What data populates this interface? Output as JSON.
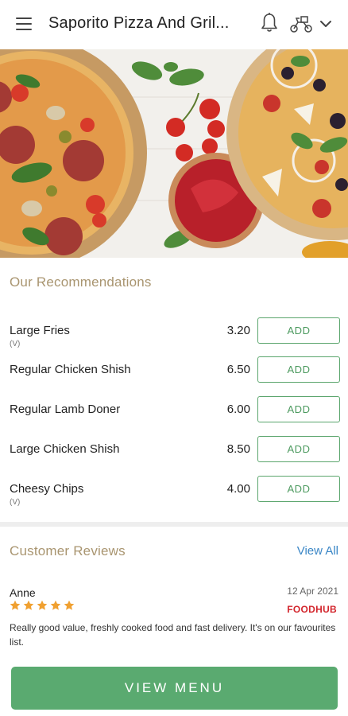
{
  "header": {
    "title": "Saporito Pizza And Gril...",
    "icons": [
      "menu-icon",
      "bell-icon",
      "delivery-bike-icon",
      "chevron-down-icon"
    ]
  },
  "recommendations": {
    "title": "Our Recommendations",
    "add_label": "ADD",
    "items": [
      {
        "name": "Large Fries",
        "tag": "(V)",
        "price": "3.20"
      },
      {
        "name": "Regular Chicken Shish",
        "tag": "",
        "price": "6.50"
      },
      {
        "name": "Regular Lamb Doner",
        "tag": "",
        "price": "6.00"
      },
      {
        "name": "Large Chicken Shish",
        "tag": "",
        "price": "8.50"
      },
      {
        "name": "Cheesy Chips",
        "tag": "(V)",
        "price": "4.00"
      }
    ]
  },
  "reviews": {
    "title": "Customer Reviews",
    "view_all": "View All",
    "items": [
      {
        "author": "Anne",
        "date": "12 Apr 2021",
        "rating": 5,
        "source": "FOODHUB",
        "text": "Really good value, freshly cooked food and fast delivery. It's on our favourites list."
      }
    ]
  },
  "cta": {
    "view_menu": "VIEW MENU"
  },
  "colors": {
    "accent_green": "#5aaa70",
    "section_title": "#a99570",
    "link_blue": "#3a86c6",
    "star": "#f0a030",
    "foodhub_red": "#d3262d"
  }
}
